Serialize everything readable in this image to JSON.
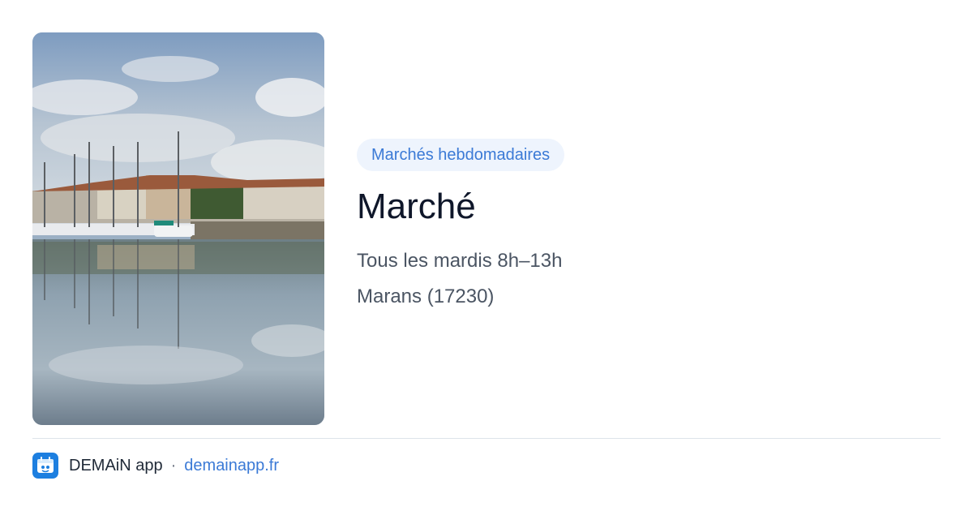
{
  "event": {
    "category": "Marchés hebdomadaires",
    "title": "Marché",
    "schedule": "Tous les mardis 8h–13h",
    "location": "Marans (17230)"
  },
  "footer": {
    "app_name": "DEMAiN app",
    "separator": "·",
    "url": "demainapp.fr"
  },
  "icons": {
    "app_logo": "demain-app-logo-icon"
  },
  "colors": {
    "accent": "#3b7ad6",
    "pill_background": "#eef4fd",
    "title": "#0f172a",
    "detail": "#4b5563",
    "logo": "#1d7fe0"
  }
}
